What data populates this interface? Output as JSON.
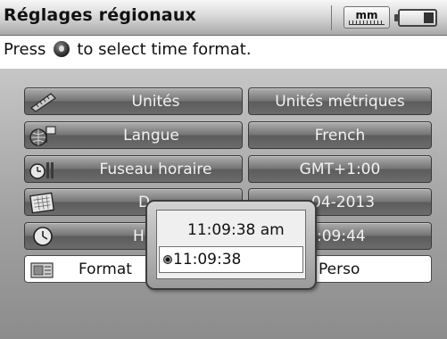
{
  "header": {
    "title": "Réglages régionaux",
    "unit_indicator": "mm",
    "battery_level": 0.3
  },
  "hint": {
    "before": "Press",
    "after": "to select time format."
  },
  "settings": [
    {
      "icon": "ruler-icon",
      "label": "Unités",
      "value": "Unités métriques"
    },
    {
      "icon": "globe-flag-icon",
      "label": "Langue",
      "value": "French"
    },
    {
      "icon": "timezone-clock-icon",
      "label": "Fuseau horaire",
      "value": "GMT+1:00"
    },
    {
      "icon": "calendar-icon",
      "label": "D",
      "value": "04-2013"
    },
    {
      "icon": "clock-icon",
      "label": "H",
      "value": ":09:44"
    },
    {
      "icon": "format-icon",
      "label": "Format",
      "value": "Perso"
    }
  ],
  "popup": {
    "options": [
      "11:09:38 am",
      "11:09:38"
    ],
    "selected_index": 1
  },
  "colors": {
    "button_gradient_top": "#aeaeae",
    "button_gradient_bottom": "#5c5c5c",
    "panel_background": "#a1a1a1",
    "selected_row": "#ffffff"
  }
}
